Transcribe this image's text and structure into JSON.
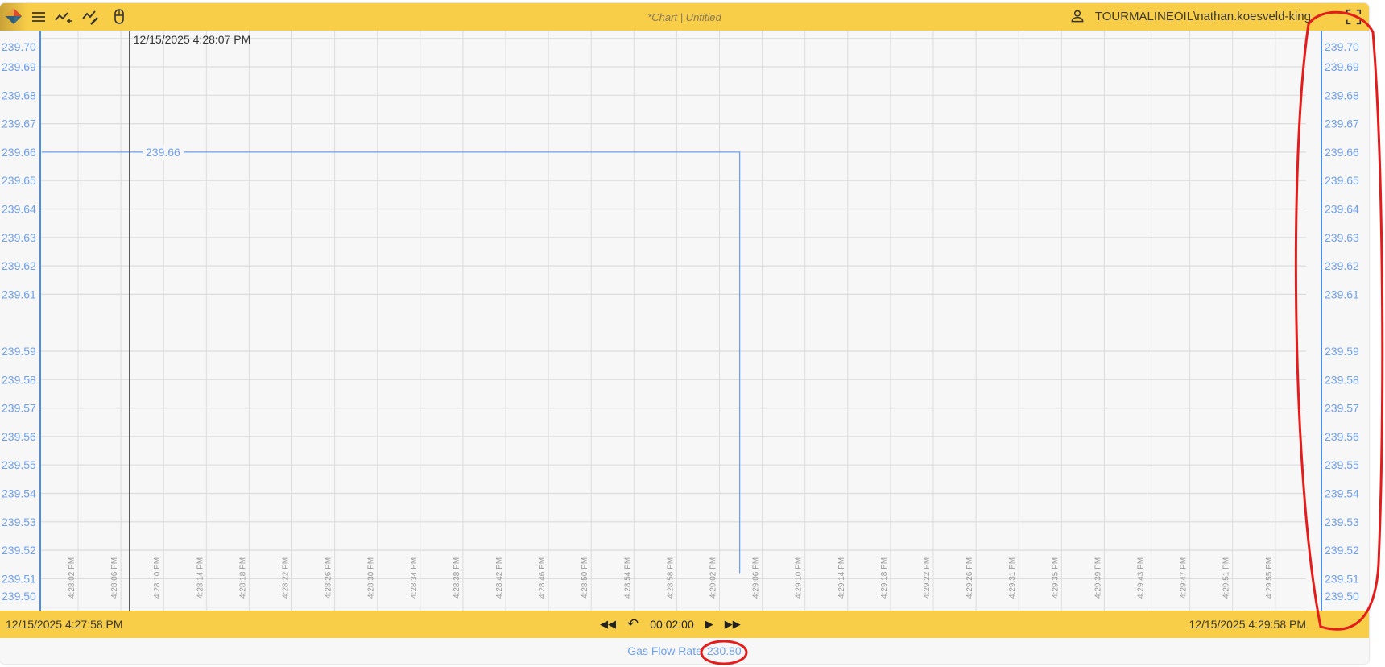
{
  "header": {
    "title": "*Chart | Untitled",
    "user": "TOURMALINEOIL\\nathan.koesveld-king",
    "icons": [
      "app-logo",
      "menu-icon",
      "add-trend-icon",
      "edit-trend-icon",
      "mouse-icon",
      "user-icon",
      "fullscreen-icon"
    ]
  },
  "cursor": {
    "label": "12/15/2025 4:28:07 PM",
    "time_s": 9.4
  },
  "footer": {
    "start": "12/15/2025  4:27:58 PM",
    "end": "12/15/2025  4:29:58 PM",
    "duration": "00:02:00",
    "controls": [
      "rewind",
      "undo",
      "play",
      "fast-forward"
    ]
  },
  "legend": {
    "name": "Gas Flow Rate",
    "value": "230.80",
    "color": "#6fa0ee"
  },
  "chart_data": {
    "type": "line",
    "title": "",
    "x_unit": "seconds since 4:27:58 PM",
    "xlim": [
      0,
      120
    ],
    "ylim": [
      239.5,
      239.7
    ],
    "y_ticks": [
      "239.70",
      "239.69",
      "239.68",
      "239.67",
      "239.66",
      "239.65",
      "239.64",
      "239.63",
      "239.62",
      "239.61",
      "239.59",
      "239.58",
      "239.57",
      "239.56",
      "239.55",
      "239.54",
      "239.53",
      "239.52",
      "239.51",
      "239.50"
    ],
    "x_ticks": [
      "4:28:02 PM",
      "4:28:06 PM",
      "4:28:10 PM",
      "4:28:14 PM",
      "4:28:18 PM",
      "4:28:22 PM",
      "4:28:26 PM",
      "4:28:30 PM",
      "4:28:34 PM",
      "4:28:38 PM",
      "4:28:42 PM",
      "4:28:46 PM",
      "4:28:50 PM",
      "4:28:54 PM",
      "4:28:58 PM",
      "4:29:02 PM",
      "4:29:06 PM",
      "4:29:10 PM",
      "4:29:14 PM",
      "4:29:18 PM",
      "4:29:22 PM",
      "4:29:26 PM",
      "4:29:31 PM",
      "4:29:35 PM",
      "4:29:39 PM",
      "4:29:43 PM",
      "4:29:47 PM",
      "4:29:51 PM",
      "4:29:55 PM"
    ],
    "series": [
      {
        "name": "Gas Flow Rate",
        "color": "#6fa0ee",
        "points": [
          [
            0,
            239.66
          ],
          [
            67,
            239.66
          ],
          [
            67,
            239.512
          ]
        ],
        "value_label": "239.66"
      }
    ]
  }
}
